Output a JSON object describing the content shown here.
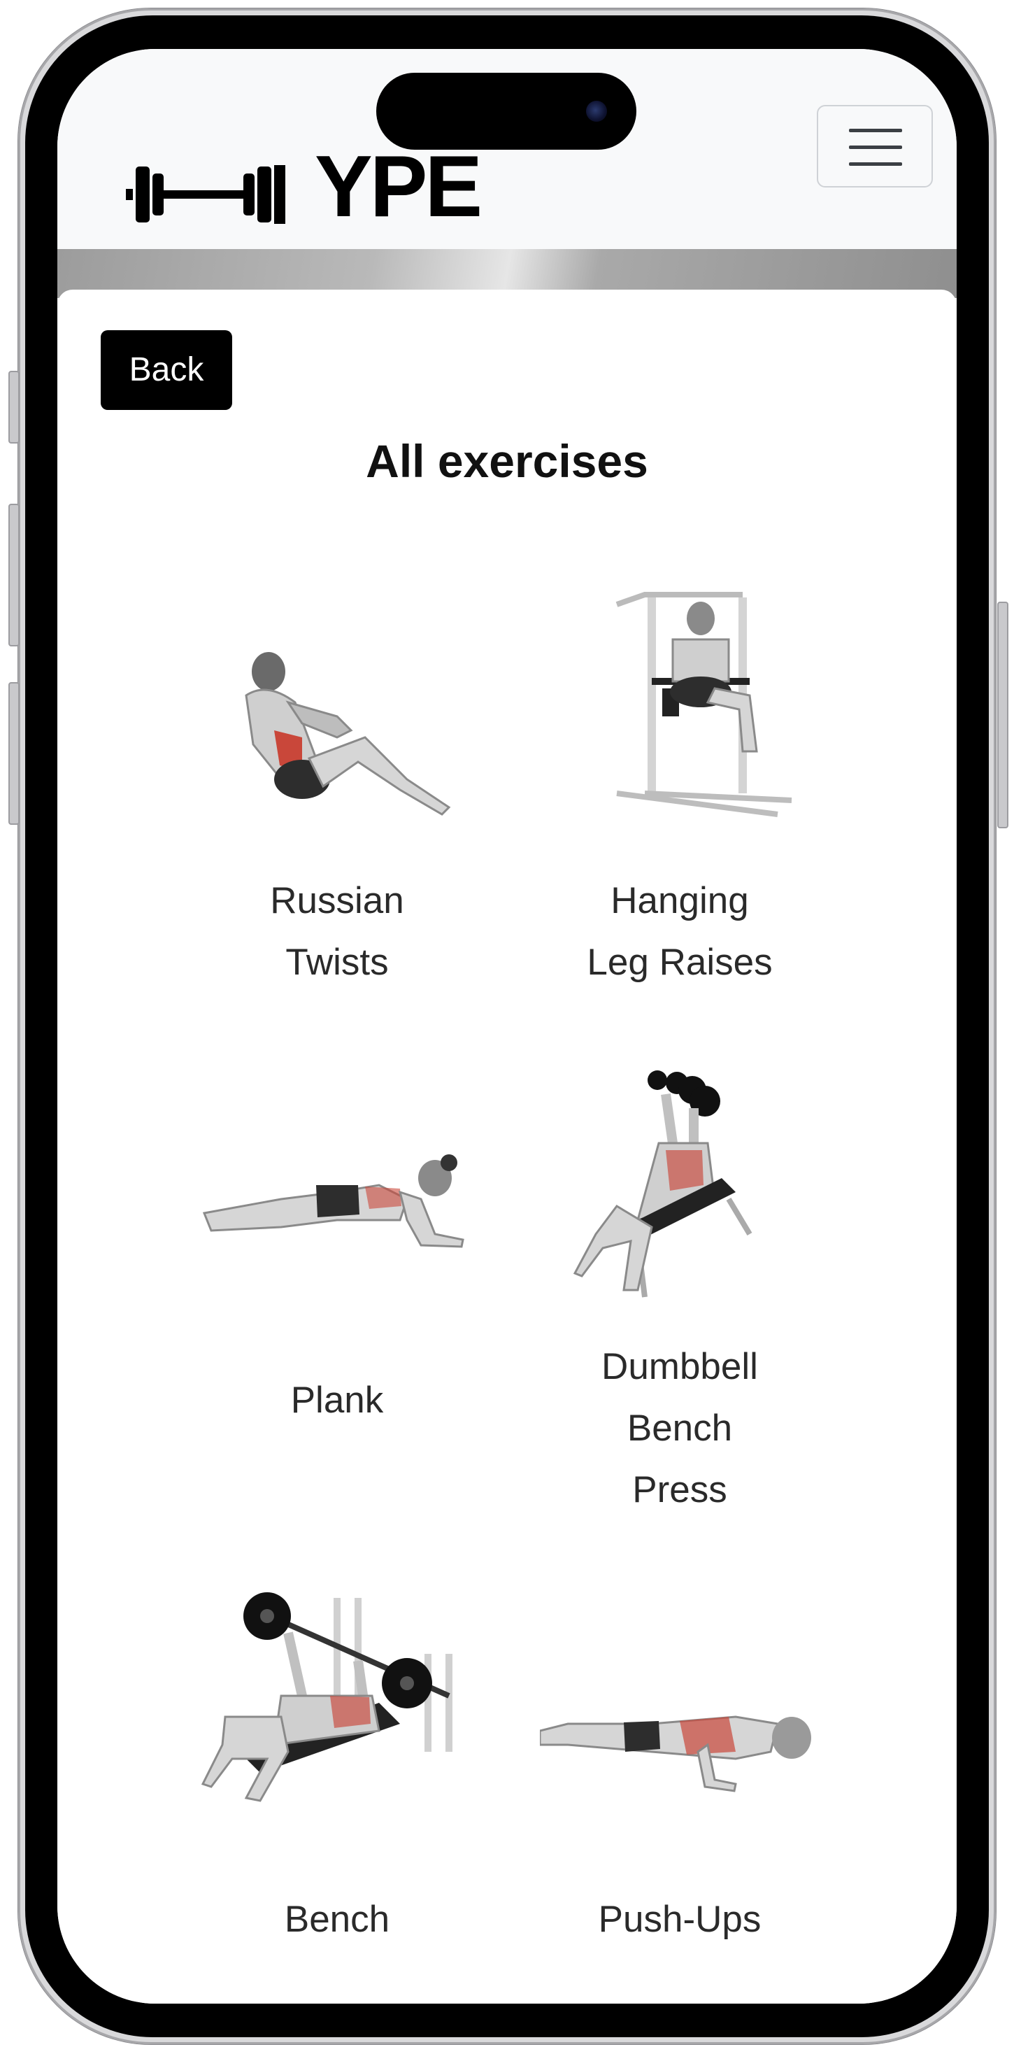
{
  "navbar": {
    "brand_text": "YPE",
    "menu_icon": "hamburger-menu-icon"
  },
  "page": {
    "back_label": "Back",
    "title": "All exercises"
  },
  "exercises": [
    {
      "name_line1": "Russian",
      "name_line2": "Twists",
      "name_line3": "",
      "image": "russian-twist-illustration"
    },
    {
      "name_line1": "Hanging",
      "name_line2": "Leg Raises",
      "name_line3": "",
      "image": "hanging-leg-raise-illustration"
    },
    {
      "name_line1": "Plank",
      "name_line2": "",
      "name_line3": "",
      "image": "plank-illustration"
    },
    {
      "name_line1": "Dumbbell",
      "name_line2": "Bench",
      "name_line3": "Press",
      "image": "dumbbell-bench-press-illustration"
    },
    {
      "name_line1": "Bench",
      "name_line2": "",
      "name_line3": "",
      "image": "barbell-bench-press-illustration"
    },
    {
      "name_line1": "Push-Ups",
      "name_line2": "",
      "name_line3": "",
      "image": "push-ups-illustration"
    }
  ],
  "colors": {
    "navbar_bg": "#f8f9fa",
    "button_bg": "#000000",
    "muscle_highlight": "#c9473a"
  }
}
